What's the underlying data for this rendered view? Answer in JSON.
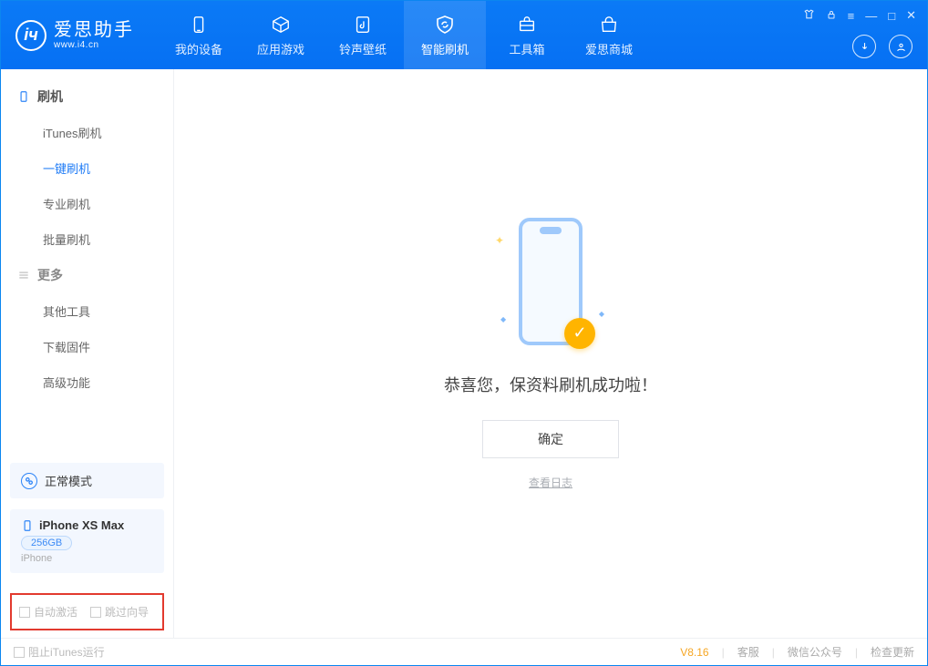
{
  "brand": {
    "name": "爱思助手",
    "url": "www.i4.cn"
  },
  "tabs": [
    {
      "label": "我的设备"
    },
    {
      "label": "应用游戏"
    },
    {
      "label": "铃声壁纸"
    },
    {
      "label": "智能刷机"
    },
    {
      "label": "工具箱"
    },
    {
      "label": "爱思商城"
    }
  ],
  "sidebar": {
    "group1": {
      "title": "刷机",
      "items": [
        "iTunes刷机",
        "一键刷机",
        "专业刷机",
        "批量刷机"
      ]
    },
    "group2": {
      "title": "更多",
      "items": [
        "其他工具",
        "下载固件",
        "高级功能"
      ]
    }
  },
  "mode_card": {
    "label": "正常模式"
  },
  "device": {
    "name": "iPhone XS Max",
    "capacity": "256GB",
    "type": "iPhone"
  },
  "options": {
    "auto_activate": "自动激活",
    "skip_guide": "跳过向导"
  },
  "main": {
    "success_text": "恭喜您，保资料刷机成功啦！",
    "ok_label": "确定",
    "log_link": "查看日志"
  },
  "status": {
    "block_itunes": "阻止iTunes运行",
    "version": "V8.16",
    "links": [
      "客服",
      "微信公众号",
      "检查更新"
    ]
  }
}
